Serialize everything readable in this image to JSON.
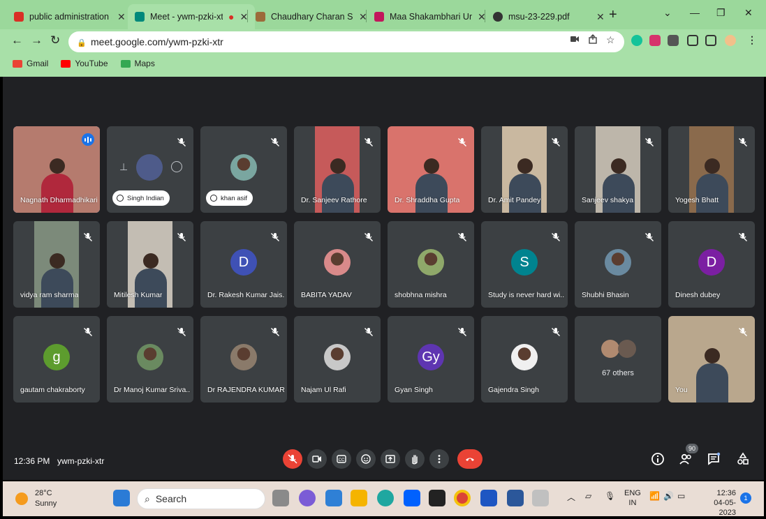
{
  "browser": {
    "tabs": [
      {
        "label": "public administration as a",
        "color": "#d93025",
        "active": false
      },
      {
        "label": "Meet - ywm-pzki-xtr",
        "color": "#00897b",
        "active": true
      },
      {
        "label": "Chaudhary Charan Singh",
        "color": "#9c6b3a",
        "active": false
      },
      {
        "label": "Maa Shakambhari Univer",
        "color": "#c2185b",
        "active": false
      },
      {
        "label": "msu-23-229.pdf",
        "color": "#333333",
        "active": false
      }
    ],
    "url": "meet.google.com/ywm-pzki-xtr",
    "bookmarks": [
      {
        "label": "Gmail",
        "color": "#ea4335"
      },
      {
        "label": "YouTube",
        "color": "#ff0000"
      },
      {
        "label": "Maps",
        "color": "#34a853"
      }
    ]
  },
  "meeting": {
    "time": "12:36 PM",
    "code": "ywm-pzki-xtr",
    "participant_count": "90",
    "tiles": [
      {
        "name": "Nagnath Dharmadhikari",
        "kind": "video",
        "bg": "#b57b6e",
        "speaking": true
      },
      {
        "name": "Singh Indian",
        "kind": "pill",
        "bg": "#3c4043"
      },
      {
        "name": "khan asif",
        "kind": "pill-photo",
        "bg": "#3c4043",
        "photo": "#7aa6a0"
      },
      {
        "name": "Dr. Sanjeev Rathore",
        "kind": "video",
        "bg": "#c65a5a"
      },
      {
        "name": "Dr. Shraddha Gupta",
        "kind": "video",
        "bg": "#d9736c"
      },
      {
        "name": "Dr. Amit Pandey",
        "kind": "video",
        "bg": "#c9b8a0"
      },
      {
        "name": "Sanjeev shakya",
        "kind": "video",
        "bg": "#bdb6aa"
      },
      {
        "name": "Yogesh Bhatt",
        "kind": "video",
        "bg": "#8a6a4c"
      },
      {
        "name": "vidya ram sharma",
        "kind": "video",
        "bg": "#7c8a7a"
      },
      {
        "name": "Mitilesh Kumar",
        "kind": "video",
        "bg": "#c3bdb3"
      },
      {
        "name": "Dr. Rakesh Kumar Jais...",
        "kind": "letter",
        "letter": "D",
        "color": "#3f51b5"
      },
      {
        "name": "BABITA YADAV",
        "kind": "photo",
        "photo": "#d98a8a"
      },
      {
        "name": "shobhna mishra",
        "kind": "photo",
        "photo": "#8fa86a"
      },
      {
        "name": "Study is never hard wi...",
        "kind": "letter",
        "letter": "S",
        "color": "#00838f"
      },
      {
        "name": "Shubhi Bhasin",
        "kind": "photo",
        "photo": "#6a8aa0"
      },
      {
        "name": "Dinesh dubey",
        "kind": "letter",
        "letter": "D",
        "color": "#7b1fa2"
      },
      {
        "name": "gautam chakraborty",
        "kind": "letter",
        "letter": "g",
        "color": "#5d9c2e"
      },
      {
        "name": "Dr Manoj Kumar Sriva...",
        "kind": "photo",
        "photo": "#6a8a60"
      },
      {
        "name": "Dr RAJENDRA KUMAR",
        "kind": "photo",
        "photo": "#8a7a6a"
      },
      {
        "name": "Najam Ul Rafi",
        "kind": "photo",
        "photo": "#c8c8c8"
      },
      {
        "name": "Gyan Singh",
        "kind": "letter",
        "letter": "Gy",
        "color": "#5e35b1"
      },
      {
        "name": "Gajendra Singh",
        "kind": "photo",
        "photo": "#f0f0f0"
      },
      {
        "name": "67 others",
        "kind": "others"
      },
      {
        "name": "You",
        "kind": "video",
        "bg": "#b9a78d"
      }
    ]
  },
  "taskbar": {
    "temp": "28°C",
    "weather": "Sunny",
    "search": "Search",
    "lang1": "ENG",
    "lang2": "IN",
    "clock_time": "12:36",
    "clock_date": "04-05-2023",
    "notifications": "1"
  }
}
